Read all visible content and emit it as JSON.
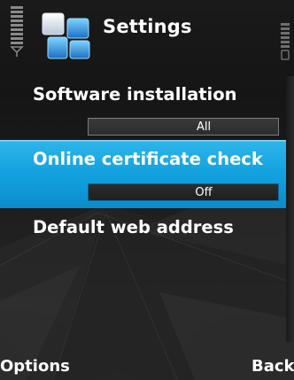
{
  "header": {
    "title": "Settings",
    "app_icon": "settings-tiles-icon",
    "signal_icon": "signal-strength-icon",
    "battery_icon": "battery-level-icon"
  },
  "list": {
    "items": [
      {
        "label": "Software installation",
        "value": "All",
        "selected": false
      },
      {
        "label": "Online certificate check",
        "value": "Off",
        "selected": true
      },
      {
        "label": "Default web address",
        "selected": false
      }
    ]
  },
  "softkeys": {
    "left": "Options",
    "right": "Back"
  },
  "colors": {
    "highlight": "#14a3e0",
    "background": "#1a1a1a",
    "text": "#ffffff"
  }
}
